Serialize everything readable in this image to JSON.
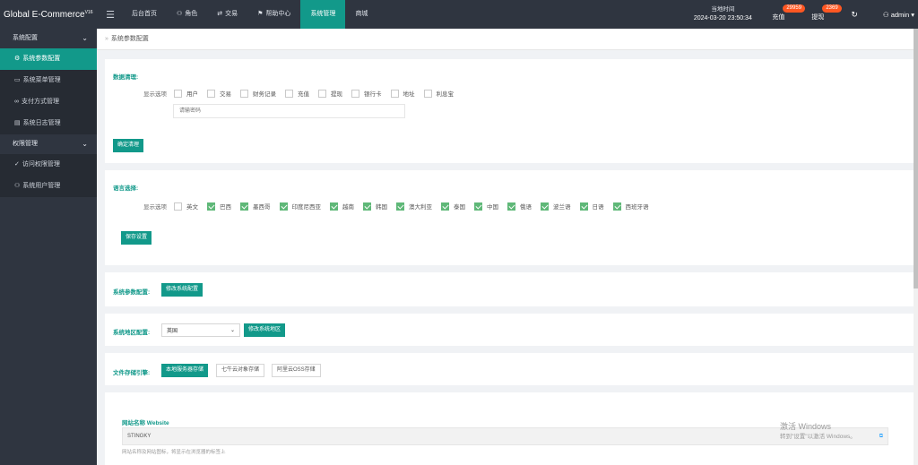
{
  "app": {
    "brand": "Global E-Commerce",
    "version": "V16"
  },
  "nav": [
    {
      "label": "后台首页",
      "icon": ""
    },
    {
      "label": "角色",
      "icon": "user-icon"
    },
    {
      "label": "交易",
      "icon": "exchange-icon"
    },
    {
      "label": "帮助中心",
      "icon": "flag-icon"
    },
    {
      "label": "系统管理",
      "icon": "",
      "active": true
    },
    {
      "label": "商城",
      "icon": ""
    }
  ],
  "header": {
    "time_label": "当地时间",
    "time_value": "2024-03-20 23:50:34",
    "recharge_label": "充值",
    "recharge_badge": "29959",
    "withdraw_label": "提现",
    "withdraw_badge": "2369",
    "user": "admin"
  },
  "sidebar": {
    "groups": [
      {
        "label": "系统配置",
        "items": [
          {
            "label": "系统参数配置",
            "icon": "gear-icon",
            "active": true
          },
          {
            "label": "系统菜单管理",
            "icon": "calendar-icon"
          },
          {
            "label": "支付方式管理",
            "icon": "link-icon"
          },
          {
            "label": "系统日志管理",
            "icon": "log-icon"
          }
        ]
      },
      {
        "label": "权限管理",
        "items": [
          {
            "label": "访问权限管理",
            "icon": "shield-check-icon"
          },
          {
            "label": "系统用户管理",
            "icon": "user-icon"
          }
        ]
      }
    ]
  },
  "breadcrumb": "系统参数配置",
  "data_clear": {
    "title": "数据清理:",
    "options_label": "显示选项",
    "options": [
      {
        "label": "用户",
        "checked": false
      },
      {
        "label": "交易",
        "checked": false
      },
      {
        "label": "财务记录",
        "checked": false
      },
      {
        "label": "充值",
        "checked": false
      },
      {
        "label": "提现",
        "checked": false
      },
      {
        "label": "银行卡",
        "checked": false
      },
      {
        "label": "地址",
        "checked": false
      },
      {
        "label": "利息宝",
        "checked": false
      }
    ],
    "password_placeholder": "请输密码",
    "confirm_button": "确定清理"
  },
  "language": {
    "title": "语言选择:",
    "options_label": "显示选项",
    "options": [
      {
        "label": "英文",
        "checked": false
      },
      {
        "label": "巴西",
        "checked": true
      },
      {
        "label": "墨西哥",
        "checked": true
      },
      {
        "label": "印度尼西亚",
        "checked": true
      },
      {
        "label": "越南",
        "checked": true
      },
      {
        "label": "韩国",
        "checked": true
      },
      {
        "label": "澳大利亚",
        "checked": true
      },
      {
        "label": "泰国",
        "checked": true
      },
      {
        "label": "中国",
        "checked": true
      },
      {
        "label": "俄语",
        "checked": true
      },
      {
        "label": "波兰语",
        "checked": true
      },
      {
        "label": "日语",
        "checked": true
      },
      {
        "label": "西班牙语",
        "checked": true
      }
    ],
    "save_button": "保存设置"
  },
  "sys_params": {
    "title": "系统参数配置:",
    "button": "修改系统配置"
  },
  "region": {
    "title": "系统地区配置:",
    "selected": "英国",
    "button": "修改系统地区"
  },
  "storage": {
    "title": "文件存储引擎:",
    "buttons": [
      {
        "label": "本地服务器存储",
        "active": true
      },
      {
        "label": "七牛云对象存储",
        "active": false
      },
      {
        "label": "阿里云OSS存储",
        "active": false
      }
    ]
  },
  "website": {
    "title": "网站名称 Website",
    "value": "STINGKY",
    "hint": "网站名称及网站图标，将显示在浏览器的标签上"
  },
  "watermark": {
    "activate_line1": "激活 Windows",
    "activate_line2": "转到\"设置\"以激活 Windows。"
  }
}
